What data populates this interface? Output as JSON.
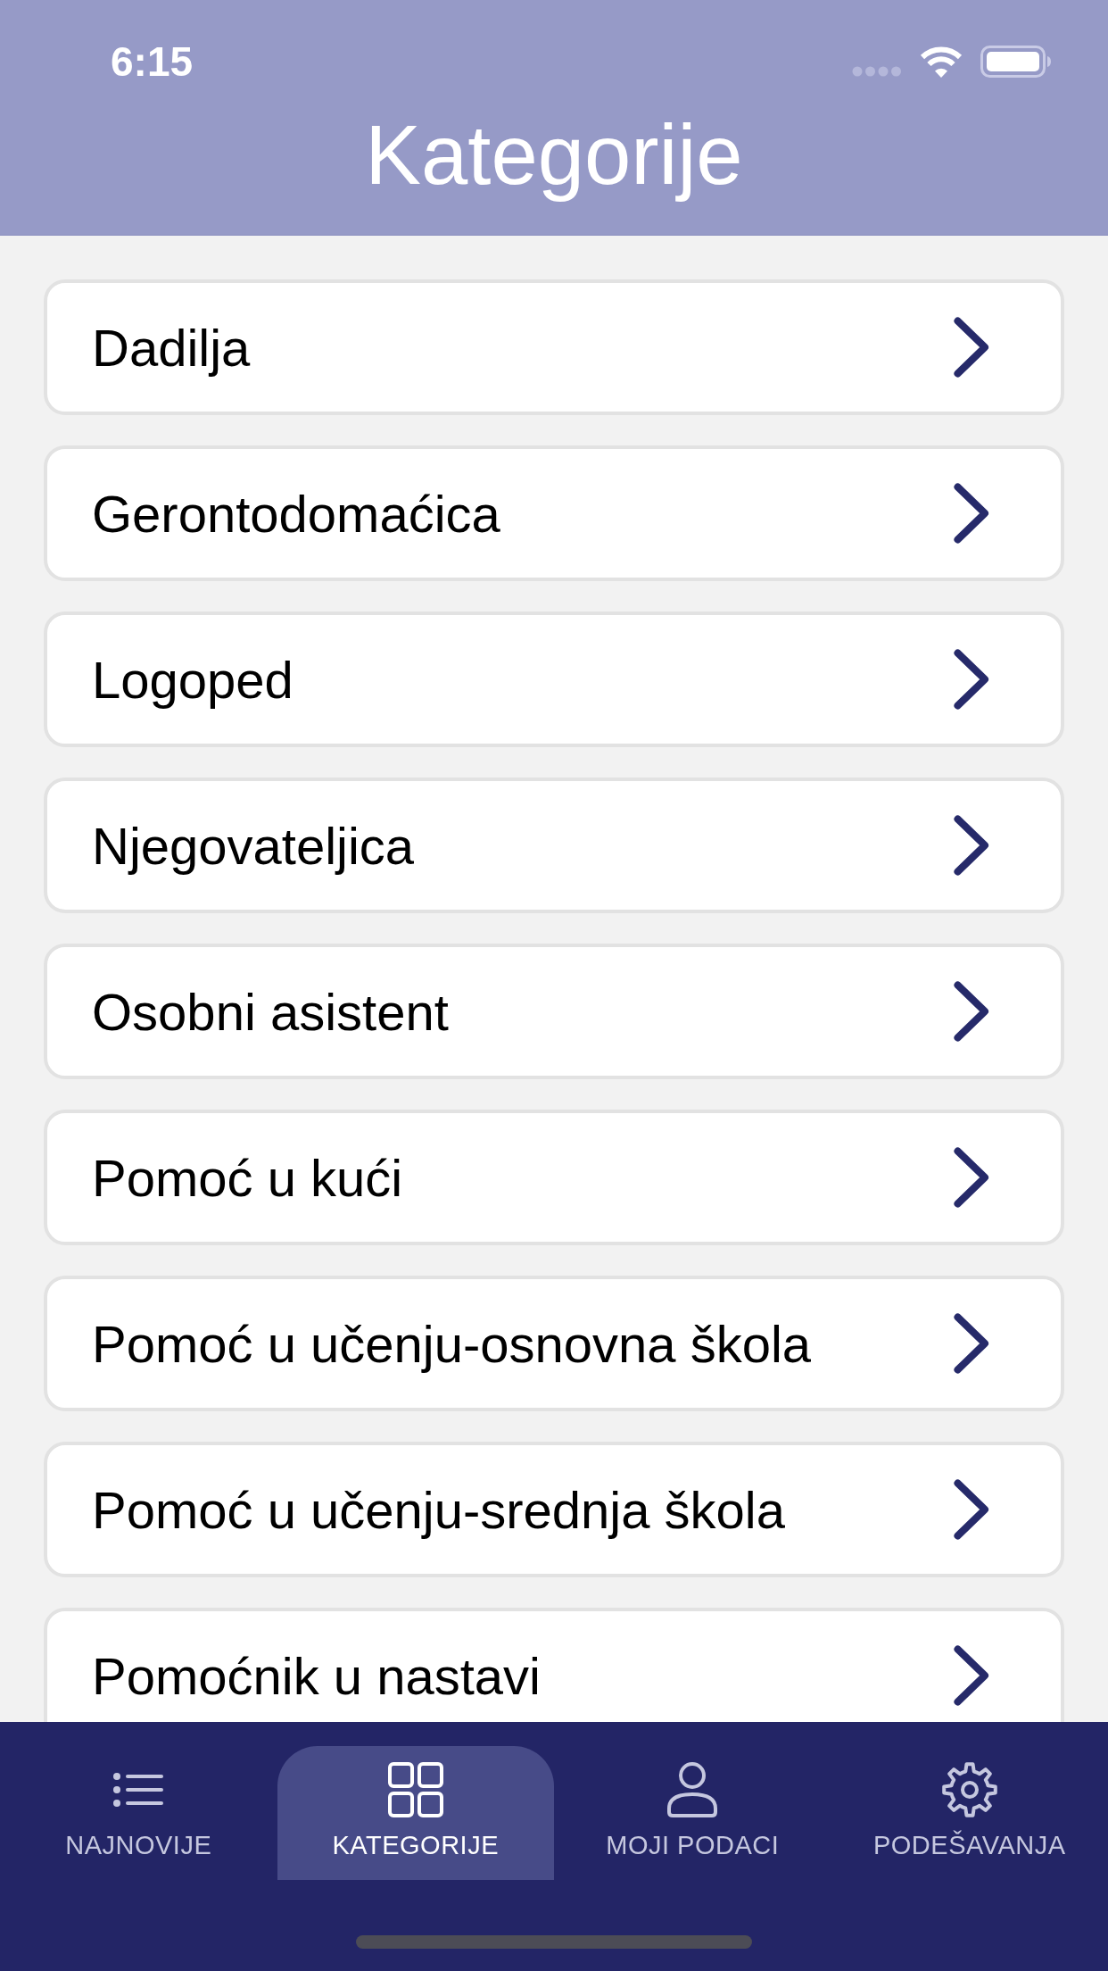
{
  "status_bar": {
    "time": "6:15"
  },
  "navigation_bar": {
    "title": "Kategorije"
  },
  "categories": [
    {
      "label": "Dadilja"
    },
    {
      "label": "Gerontodomaćica"
    },
    {
      "label": "Logoped"
    },
    {
      "label": "Njegovateljica"
    },
    {
      "label": "Osobni asistent"
    },
    {
      "label": "Pomoć u kući"
    },
    {
      "label": "Pomoć u učenju-osnovna škola"
    },
    {
      "label": "Pomoć u učenju-srednja škola"
    },
    {
      "label": "Pomoćnik u nastavi"
    }
  ],
  "tab_bar": {
    "tabs": [
      {
        "label": "NAJNOVIJE",
        "selected": false
      },
      {
        "label": "KATEGORIJE",
        "selected": true
      },
      {
        "label": "MOJI PODACI",
        "selected": false
      },
      {
        "label": "PODEŠAVANJA",
        "selected": false
      }
    ]
  }
}
